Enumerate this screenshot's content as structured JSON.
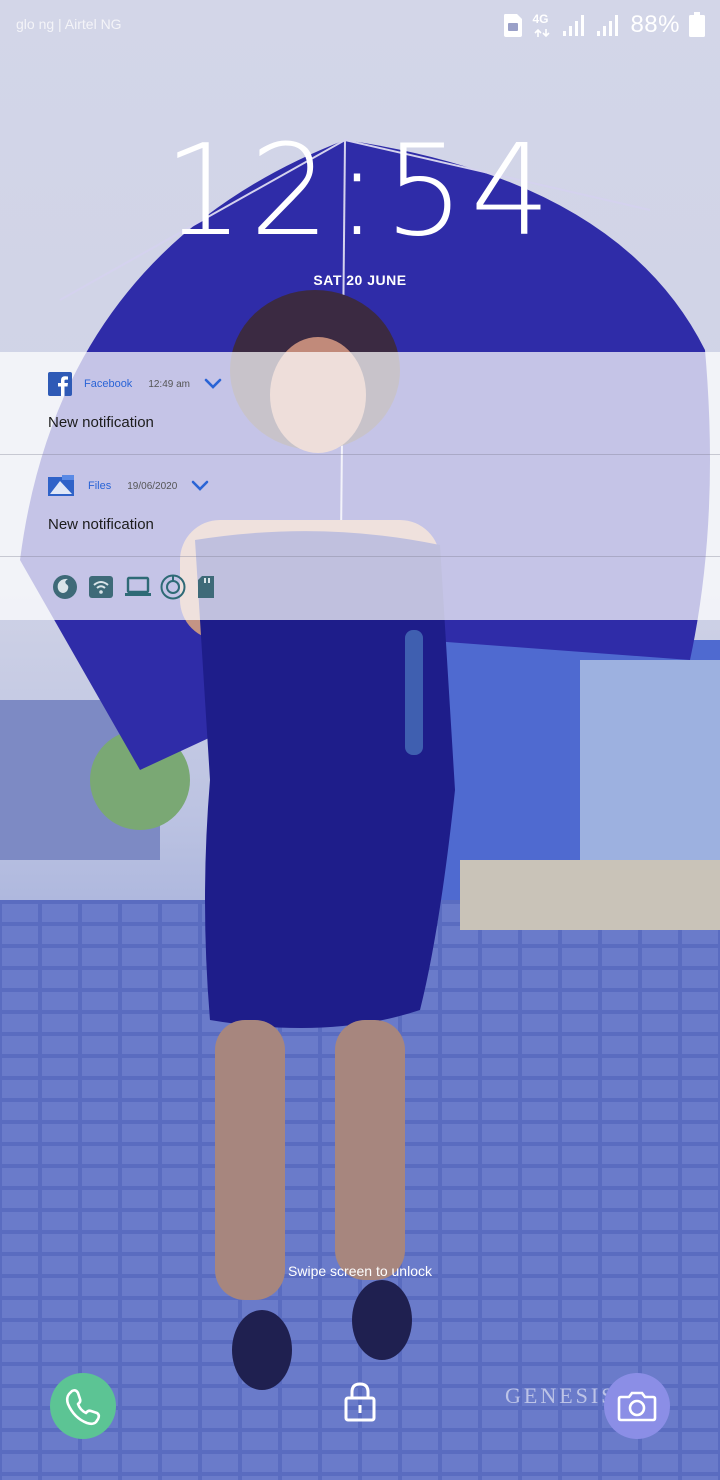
{
  "status_bar": {
    "carrier": "glo ng | Airtel NG",
    "network_type": "4G",
    "battery_percent": "88%"
  },
  "lockscreen": {
    "time": "12:54",
    "date": "SAT 20 JUNE",
    "swipe_hint": "Swipe screen to unlock",
    "watermark": "GENESIS"
  },
  "notifications": [
    {
      "app": "Facebook",
      "time": "12:49 am",
      "text": "New notification",
      "icon": "facebook-icon"
    },
    {
      "app": "Files",
      "time": "19/06/2020",
      "text": "New notification",
      "icon": "files-icon"
    }
  ],
  "notification_icons": [
    "firefox-icon",
    "wifi-hotspot-icon",
    "laptop-icon",
    "sync-icon",
    "sd-card-icon"
  ],
  "colors": {
    "accent": "#2a64d6",
    "phone": "#5cc494",
    "camera": "#8b8ee6"
  }
}
